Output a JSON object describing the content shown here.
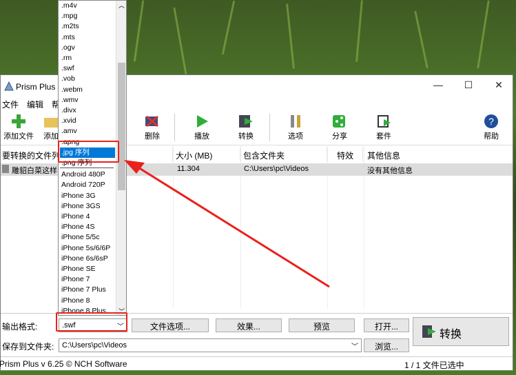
{
  "window": {
    "title": "Prism Plus",
    "controls": {
      "minimize": "—",
      "maximize": "☐",
      "close": "✕"
    }
  },
  "menu": [
    "文件",
    "编辑",
    "帮"
  ],
  "toolbar": {
    "add_file": "添加文件",
    "add_folder": "添加",
    "delete": "删除",
    "play": "播放",
    "convert": "转换",
    "options": "选项",
    "share": "分享",
    "suite": "套件",
    "help": "帮助"
  },
  "file_list": {
    "headers": {
      "name": "要转换的文件列",
      "size": "大小 (MB)",
      "folder": "包含文件夹",
      "effects": "特效",
      "info": "其他信息"
    },
    "rows": [
      {
        "name": "雕貂白菜这样",
        "size": "11.304",
        "folder": "C:\\Users\\pc\\Videos",
        "effects": "",
        "info": "没有其他信息"
      }
    ]
  },
  "dropdown": {
    "items": [
      ".m4v",
      ".mpg",
      ".m2ts",
      ".mts",
      ".ogv",
      ".rm",
      ".swf",
      ".vob",
      ".webm",
      ".wmv",
      ".divx",
      ".xvid",
      ".amv",
      ".apng",
      ".jpg 序列",
      ".png 序列",
      "Android 480P",
      "Android 720P",
      "iPhone 3G",
      "iPhone 3GS",
      "iPhone 4",
      "iPhone 4S",
      "iPhone 5/5c",
      "iPhone 5s/6/6P",
      "iPhone 6s/6sP",
      "iPhone SE",
      "iPhone 7",
      "iPhone 7 Plus",
      "iPhone 8",
      "iPhone 8 Plus"
    ],
    "selected": ".jpg 序列"
  },
  "output": {
    "format_label": "输出格式:",
    "format_value": ".swf",
    "file_options": "文件选项...",
    "effects": "效果...",
    "preview": "预览",
    "open": "打开...",
    "save_label": "保存到文件夹:",
    "save_path": "C:\\Users\\pc\\Videos",
    "browse": "浏览...",
    "convert": "转换"
  },
  "status": {
    "left": "Prism Plus v 6.25 © NCH Software",
    "right": "1 / 1 文件已选中"
  },
  "colors": {
    "highlight": "#0078d7",
    "annotation_red": "#e8221c"
  }
}
